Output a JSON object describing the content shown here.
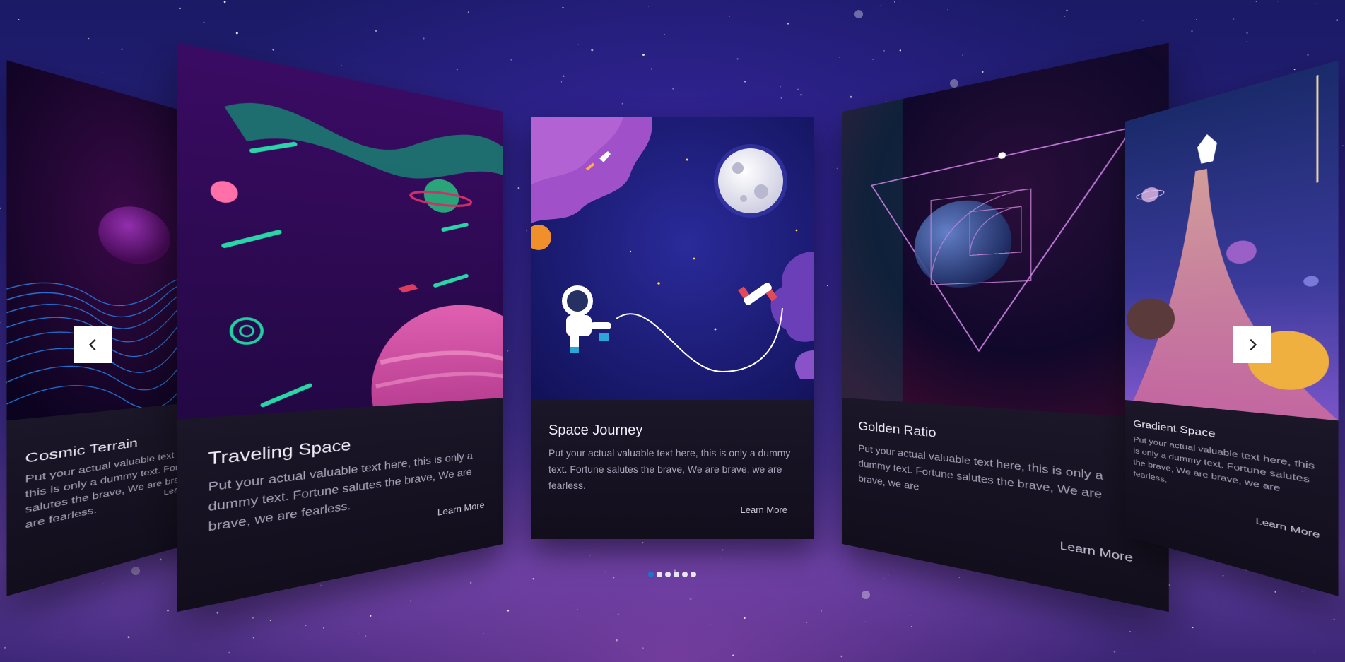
{
  "slides": [
    {
      "title": "Cosmic Terrain",
      "text": "Put your actual valuable text here, this is only a dummy text. Fortune salutes the brave, We are brave, we are fearless.",
      "link": "Learn More"
    },
    {
      "title": "Traveling Space",
      "text": "Put your actual valuable text here, this is only a dummy text. Fortune salutes the brave, We are brave, we are fearless.",
      "link": "Learn More"
    },
    {
      "title": "Space Journey",
      "text": "Put your actual valuable text here, this is only a dummy text. Fortune salutes the brave, We are brave, we are fearless.",
      "link": "Learn More"
    },
    {
      "title": "Golden Ratio",
      "text": "Put your actual valuable text here, this is only a dummy text. Fortune salutes the brave, We are brave, we are",
      "link": "Learn More"
    },
    {
      "title": "Gradient Space",
      "text": "Put your actual valuable text here, this is only a dummy text. Fortune salutes the brave, We are brave, we are fearless.",
      "link": "Learn More"
    }
  ],
  "navigation": {
    "prev_icon": "chevron-left-icon",
    "next_icon": "chevron-right-icon"
  },
  "pagination": {
    "count": 6,
    "active_index": 0,
    "active_color": "#1e74c8"
  },
  "colors": {
    "background": "#2a1f82",
    "card_body": "#141022",
    "title": "#f1eef8",
    "body_text": "#a9a4b8"
  }
}
